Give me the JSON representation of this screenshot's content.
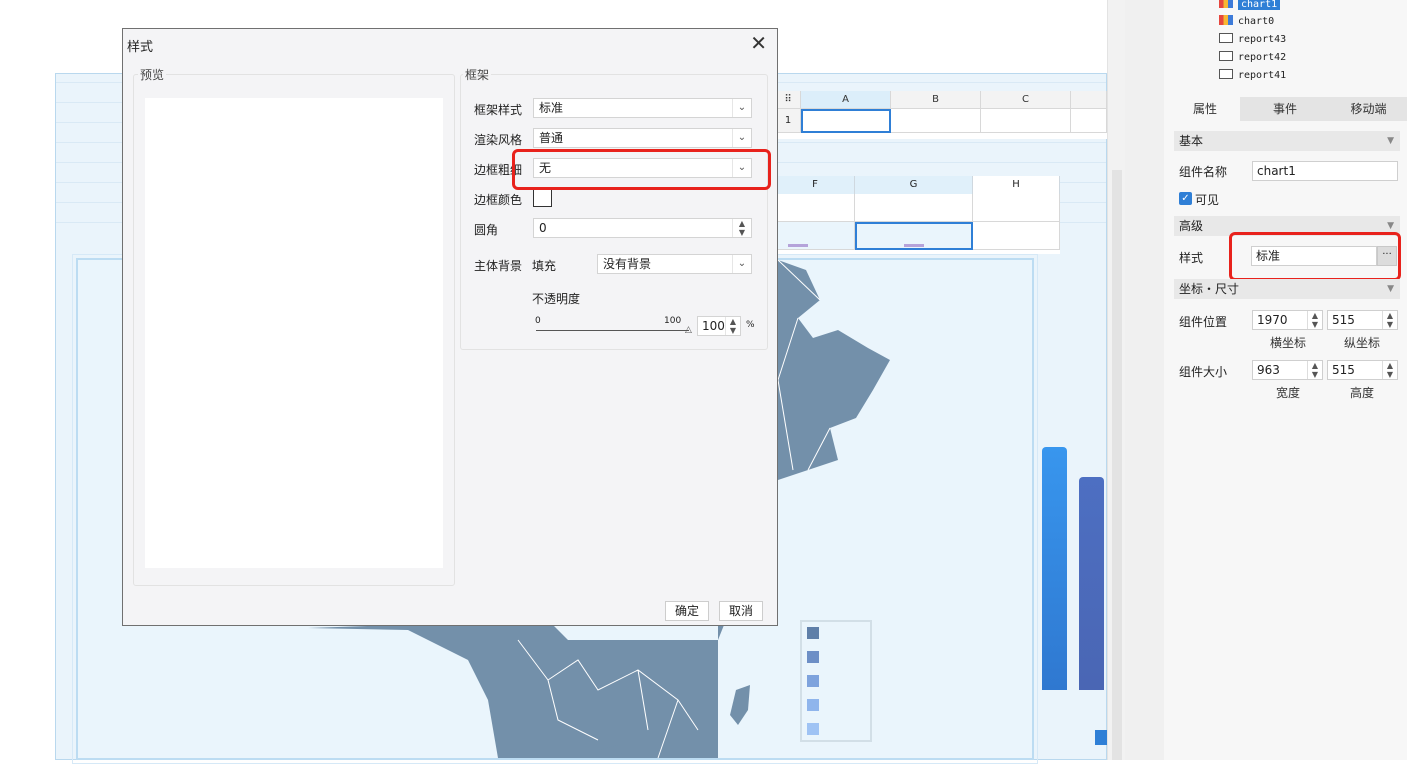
{
  "dialog": {
    "title": "样式",
    "preview_group": "预览",
    "frame_group": "框架",
    "fields": {
      "frame_style_label": "框架样式",
      "frame_style_value": "标准",
      "render_style_label": "渲染风格",
      "render_style_value": "普通",
      "border_width_label": "边框粗细",
      "border_width_value": "无",
      "border_color_label": "边框颜色",
      "radius_label": "圆角",
      "radius_value": "0",
      "body_bg_label": "主体背景",
      "fill_label": "填充",
      "bg_value": "没有背景",
      "opacity_label": "不透明度",
      "slider_min": "0",
      "slider_max": "100",
      "opacity_value": "100",
      "opacity_unit": "%"
    },
    "ok": "确定",
    "cancel": "取消"
  },
  "sheet1": {
    "columns": [
      "A",
      "B",
      "C"
    ],
    "row": "1"
  },
  "sheet2": {
    "columns": [
      "F",
      "G",
      "H"
    ]
  },
  "tree": {
    "items": [
      "chart1",
      "chart0",
      "report43",
      "report42",
      "report41"
    ]
  },
  "panel": {
    "tabs": [
      "属性",
      "事件",
      "移动端"
    ],
    "section_basic": "基本",
    "name_label": "组件名称",
    "name_value": "chart1",
    "visible_label": "可见",
    "section_advanced": "高级",
    "style_label": "样式",
    "style_value": "标准",
    "style_button": "···",
    "section_coords": "坐标・尺寸",
    "position_label": "组件位置",
    "x_value": "1970",
    "y_value": "515",
    "x_sub": "横坐标",
    "y_sub": "纵坐标",
    "size_label": "组件大小",
    "w_value": "963",
    "h_value": "515",
    "w_sub": "宽度",
    "h_sub": "高度"
  },
  "colors": {
    "map_fill": "#7390aa",
    "highlight": "#e8221c",
    "selection": "#2f7fd6"
  },
  "icons": [
    "close-icon",
    "chevron-down-icon",
    "spin-up-down-icon",
    "checkbox-checked-icon",
    "chart-icon",
    "report-icon",
    "ellipsis-icon"
  ]
}
